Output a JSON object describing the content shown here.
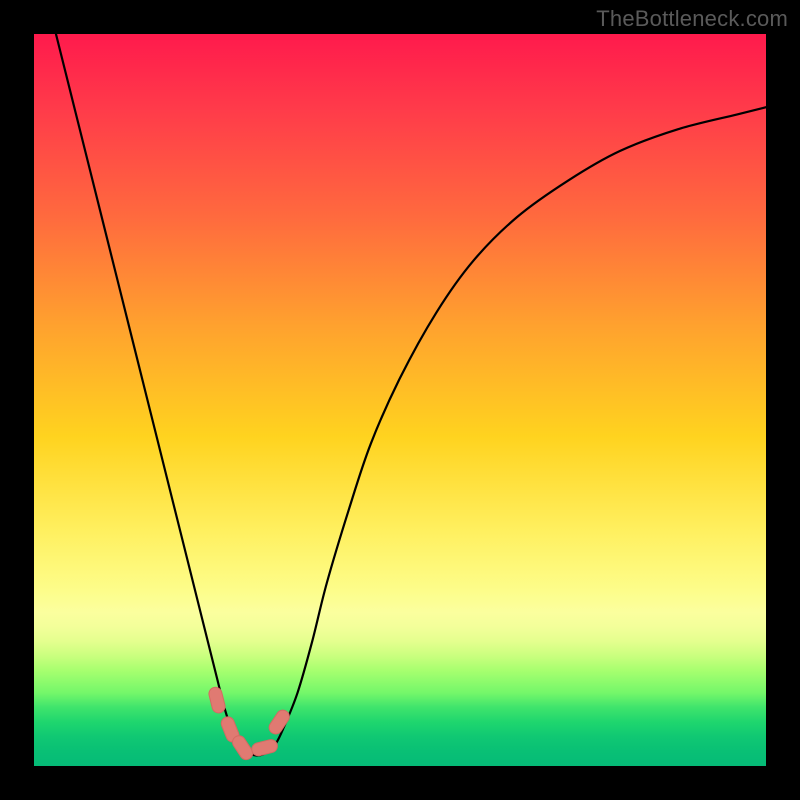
{
  "watermark": "TheBottleneck.com",
  "colors": {
    "frame": "#000000",
    "curve": "#000000",
    "marker_fill": "#e07a72",
    "marker_stroke": "#d46a62"
  },
  "chart_data": {
    "type": "line",
    "title": "",
    "xlabel": "",
    "ylabel": "",
    "xlim": [
      0,
      100
    ],
    "ylim": [
      0,
      100
    ],
    "grid": false,
    "series": [
      {
        "name": "curve",
        "x": [
          3,
          5,
          7,
          9,
          11,
          13,
          15,
          17,
          19,
          21,
          23,
          25,
          26,
          27,
          28,
          29,
          30,
          31,
          32,
          33,
          34,
          36,
          38,
          40,
          43,
          46,
          50,
          55,
          60,
          66,
          73,
          80,
          88,
          96,
          100
        ],
        "values": [
          100,
          92,
          84,
          76,
          68,
          60,
          52,
          44,
          36,
          28,
          20,
          12,
          8,
          5,
          3,
          2,
          1.5,
          1.5,
          2,
          3,
          5,
          10,
          17,
          25,
          35,
          44,
          53,
          62,
          69,
          75,
          80,
          84,
          87,
          89,
          90
        ]
      }
    ],
    "markers": [
      {
        "x": 25.0,
        "y": 9.0
      },
      {
        "x": 26.8,
        "y": 5.0
      },
      {
        "x": 28.5,
        "y": 2.5
      },
      {
        "x": 31.5,
        "y": 2.5
      },
      {
        "x": 33.5,
        "y": 6.0
      }
    ]
  }
}
